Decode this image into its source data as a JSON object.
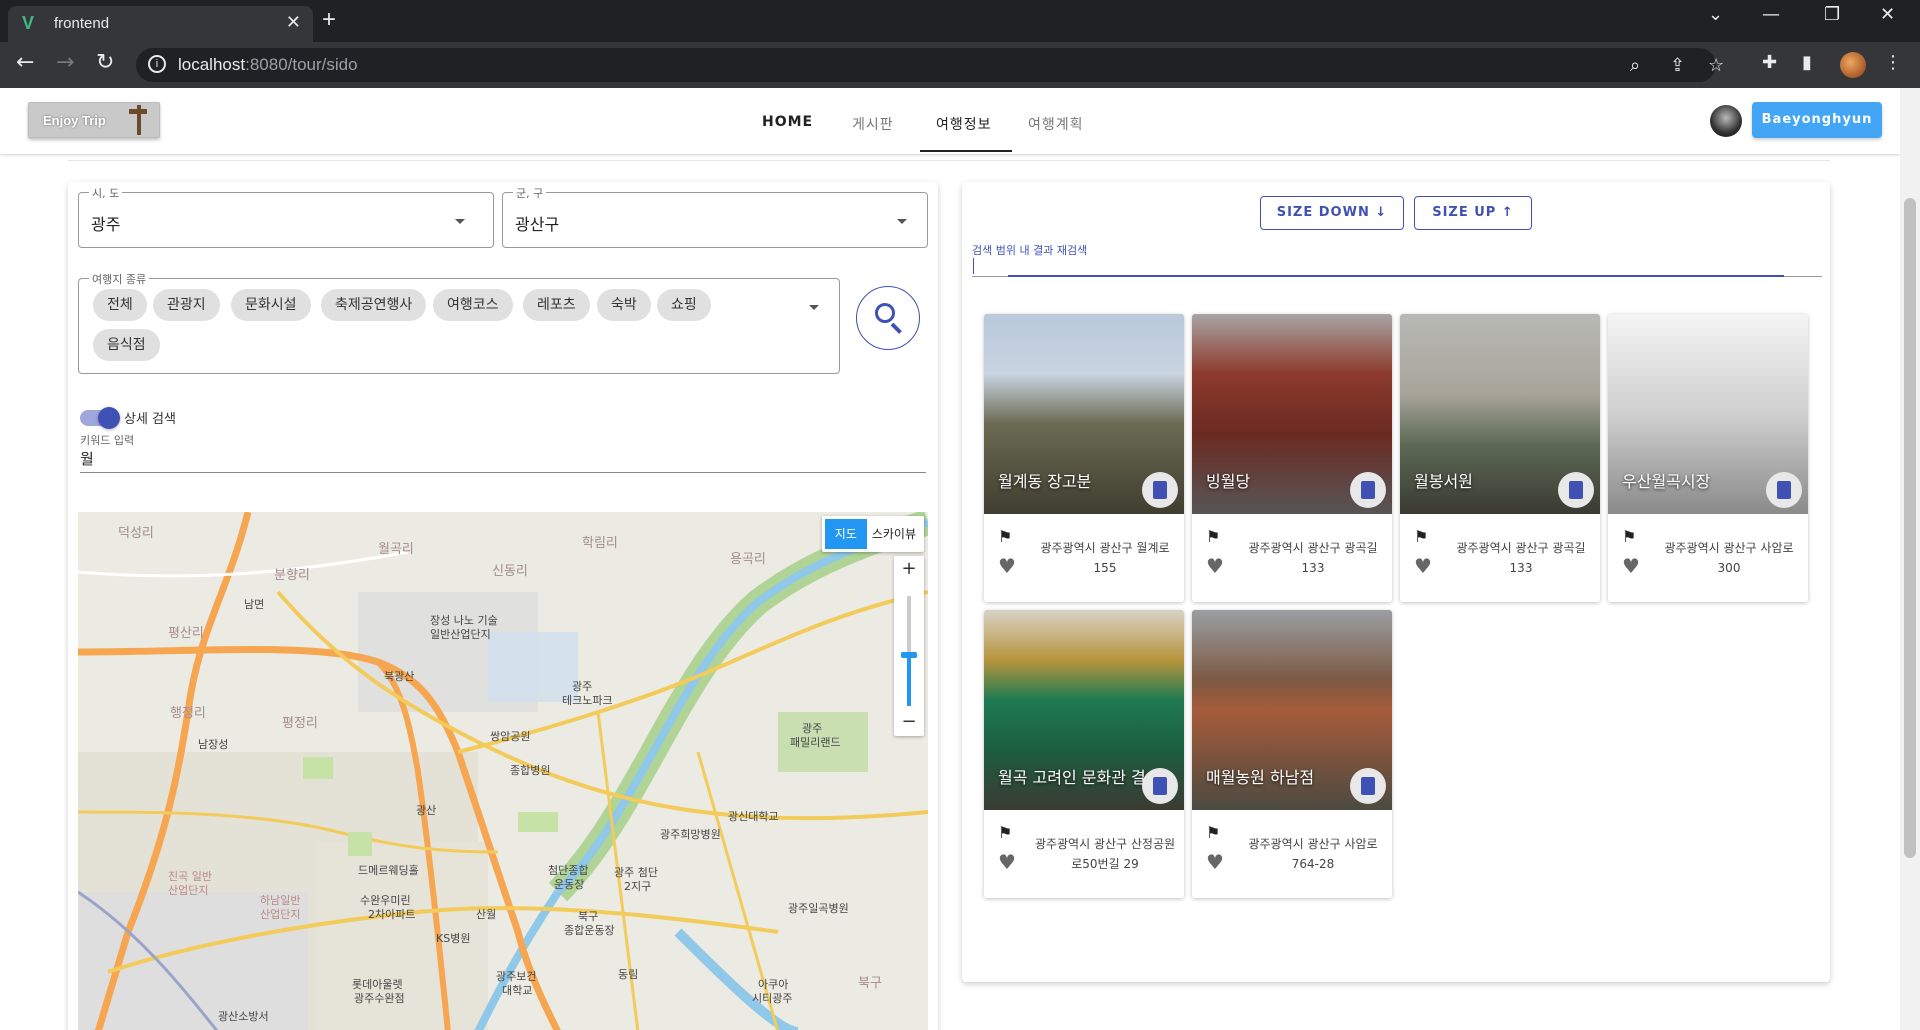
{
  "browser": {
    "tab_title": "frontend",
    "url_host": "localhost",
    "url_rest": ":8080/tour/sido"
  },
  "appbar": {
    "logo_text": "Enjoy Trip",
    "nav": [
      "HOME",
      "게시판",
      "여행정보",
      "여행계획"
    ],
    "active_nav": "여행정보",
    "user_button": "Baeyonghyun"
  },
  "filters": {
    "sido_label": "시, 도",
    "sido_value": "광주",
    "gugun_label": "군, 구",
    "gugun_value": "광산구",
    "type_label": "여행지 종류",
    "types": [
      "전체",
      "관광지",
      "문화시설",
      "축제공연행사",
      "여행코스",
      "레포츠",
      "숙박",
      "쇼핑",
      "음식점"
    ],
    "detail_toggle_label": "상세 검색",
    "detail_toggle_on": true,
    "keyword_label": "키워드 입력",
    "keyword_value": "월"
  },
  "map": {
    "type_buttons": [
      "지도",
      "스카이뷰"
    ],
    "selected_type": "지도",
    "labels": [
      "덕성리",
      "월곡리",
      "학림리",
      "남면",
      "분향리",
      "신동리",
      "용곡리",
      "평산리",
      "장성 나노 기술",
      "일반산업단지",
      "북광산",
      "광주",
      "테크노파크",
      "행정리",
      "남장성",
      "평정리",
      "쌍암공원",
      "종합병원",
      "광주",
      "패밀리랜드",
      "광산",
      "광신대학교",
      "광주희망병원",
      "드메르웨딩홀",
      "첨단종합",
      "운동장",
      "광주 첨단",
      "2지구",
      "수완우미린",
      "2차아파트",
      "진곡 일반",
      "산업단지",
      "하남일반",
      "산업단지",
      "산월",
      "북구",
      "종합운동장",
      "광주일곡병원",
      "KS병원",
      "동림",
      "롯데아울렛",
      "광주수완점",
      "광주보건",
      "대학교",
      "아쿠아",
      "시티광주",
      "북구",
      "광산소방서"
    ]
  },
  "results": {
    "size_down": "SIZE DOWN",
    "size_up": "SIZE UP",
    "refine_label": "검색 범위 내 결과 재검색",
    "cards": [
      {
        "title": "월계동 장고분",
        "address": "광주광역시 광산구 월계로 155"
      },
      {
        "title": "빙월당",
        "address": "광주광역시 광산구 광곡길 133"
      },
      {
        "title": "월봉서원",
        "address": "광주광역시 광산구 광곡길 133"
      },
      {
        "title": "우산월곡시장",
        "address": "광주광역시 광산구 사암로 300"
      },
      {
        "title": "월곡 고려인 문화관 결",
        "address": "광주광역시 광산구 산정공원로50번길 29"
      },
      {
        "title": "매월농원 하남점",
        "address": "광주광역시 광산구 사암로 764-28"
      }
    ]
  },
  "colors": {
    "accent": "#3f51b5",
    "user_button": "#42a5f5",
    "map_type_active": "#2196f3"
  },
  "icons": [
    "search-icon",
    "bookmark-icon",
    "map-search-icon",
    "heart-icon",
    "arrow-down-icon",
    "arrow-up-icon",
    "zoom-in-icon",
    "zoom-out-icon"
  ]
}
